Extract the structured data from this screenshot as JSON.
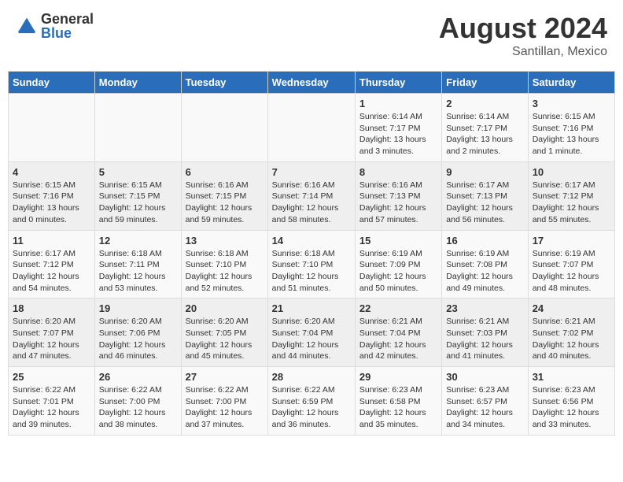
{
  "header": {
    "logo_line1": "General",
    "logo_line2": "Blue",
    "title": "August 2024",
    "subtitle": "Santillan, Mexico"
  },
  "days_of_week": [
    "Sunday",
    "Monday",
    "Tuesday",
    "Wednesday",
    "Thursday",
    "Friday",
    "Saturday"
  ],
  "weeks": [
    [
      {
        "day": "",
        "info": ""
      },
      {
        "day": "",
        "info": ""
      },
      {
        "day": "",
        "info": ""
      },
      {
        "day": "",
        "info": ""
      },
      {
        "day": "1",
        "info": "Sunrise: 6:14 AM\nSunset: 7:17 PM\nDaylight: 13 hours\nand 3 minutes."
      },
      {
        "day": "2",
        "info": "Sunrise: 6:14 AM\nSunset: 7:17 PM\nDaylight: 13 hours\nand 2 minutes."
      },
      {
        "day": "3",
        "info": "Sunrise: 6:15 AM\nSunset: 7:16 PM\nDaylight: 13 hours\nand 1 minute."
      }
    ],
    [
      {
        "day": "4",
        "info": "Sunrise: 6:15 AM\nSunset: 7:16 PM\nDaylight: 13 hours\nand 0 minutes."
      },
      {
        "day": "5",
        "info": "Sunrise: 6:15 AM\nSunset: 7:15 PM\nDaylight: 12 hours\nand 59 minutes."
      },
      {
        "day": "6",
        "info": "Sunrise: 6:16 AM\nSunset: 7:15 PM\nDaylight: 12 hours\nand 59 minutes."
      },
      {
        "day": "7",
        "info": "Sunrise: 6:16 AM\nSunset: 7:14 PM\nDaylight: 12 hours\nand 58 minutes."
      },
      {
        "day": "8",
        "info": "Sunrise: 6:16 AM\nSunset: 7:13 PM\nDaylight: 12 hours\nand 57 minutes."
      },
      {
        "day": "9",
        "info": "Sunrise: 6:17 AM\nSunset: 7:13 PM\nDaylight: 12 hours\nand 56 minutes."
      },
      {
        "day": "10",
        "info": "Sunrise: 6:17 AM\nSunset: 7:12 PM\nDaylight: 12 hours\nand 55 minutes."
      }
    ],
    [
      {
        "day": "11",
        "info": "Sunrise: 6:17 AM\nSunset: 7:12 PM\nDaylight: 12 hours\nand 54 minutes."
      },
      {
        "day": "12",
        "info": "Sunrise: 6:18 AM\nSunset: 7:11 PM\nDaylight: 12 hours\nand 53 minutes."
      },
      {
        "day": "13",
        "info": "Sunrise: 6:18 AM\nSunset: 7:10 PM\nDaylight: 12 hours\nand 52 minutes."
      },
      {
        "day": "14",
        "info": "Sunrise: 6:18 AM\nSunset: 7:10 PM\nDaylight: 12 hours\nand 51 minutes."
      },
      {
        "day": "15",
        "info": "Sunrise: 6:19 AM\nSunset: 7:09 PM\nDaylight: 12 hours\nand 50 minutes."
      },
      {
        "day": "16",
        "info": "Sunrise: 6:19 AM\nSunset: 7:08 PM\nDaylight: 12 hours\nand 49 minutes."
      },
      {
        "day": "17",
        "info": "Sunrise: 6:19 AM\nSunset: 7:07 PM\nDaylight: 12 hours\nand 48 minutes."
      }
    ],
    [
      {
        "day": "18",
        "info": "Sunrise: 6:20 AM\nSunset: 7:07 PM\nDaylight: 12 hours\nand 47 minutes."
      },
      {
        "day": "19",
        "info": "Sunrise: 6:20 AM\nSunset: 7:06 PM\nDaylight: 12 hours\nand 46 minutes."
      },
      {
        "day": "20",
        "info": "Sunrise: 6:20 AM\nSunset: 7:05 PM\nDaylight: 12 hours\nand 45 minutes."
      },
      {
        "day": "21",
        "info": "Sunrise: 6:20 AM\nSunset: 7:04 PM\nDaylight: 12 hours\nand 44 minutes."
      },
      {
        "day": "22",
        "info": "Sunrise: 6:21 AM\nSunset: 7:04 PM\nDaylight: 12 hours\nand 42 minutes."
      },
      {
        "day": "23",
        "info": "Sunrise: 6:21 AM\nSunset: 7:03 PM\nDaylight: 12 hours\nand 41 minutes."
      },
      {
        "day": "24",
        "info": "Sunrise: 6:21 AM\nSunset: 7:02 PM\nDaylight: 12 hours\nand 40 minutes."
      }
    ],
    [
      {
        "day": "25",
        "info": "Sunrise: 6:22 AM\nSunset: 7:01 PM\nDaylight: 12 hours\nand 39 minutes."
      },
      {
        "day": "26",
        "info": "Sunrise: 6:22 AM\nSunset: 7:00 PM\nDaylight: 12 hours\nand 38 minutes."
      },
      {
        "day": "27",
        "info": "Sunrise: 6:22 AM\nSunset: 7:00 PM\nDaylight: 12 hours\nand 37 minutes."
      },
      {
        "day": "28",
        "info": "Sunrise: 6:22 AM\nSunset: 6:59 PM\nDaylight: 12 hours\nand 36 minutes."
      },
      {
        "day": "29",
        "info": "Sunrise: 6:23 AM\nSunset: 6:58 PM\nDaylight: 12 hours\nand 35 minutes."
      },
      {
        "day": "30",
        "info": "Sunrise: 6:23 AM\nSunset: 6:57 PM\nDaylight: 12 hours\nand 34 minutes."
      },
      {
        "day": "31",
        "info": "Sunrise: 6:23 AM\nSunset: 6:56 PM\nDaylight: 12 hours\nand 33 minutes."
      }
    ]
  ]
}
